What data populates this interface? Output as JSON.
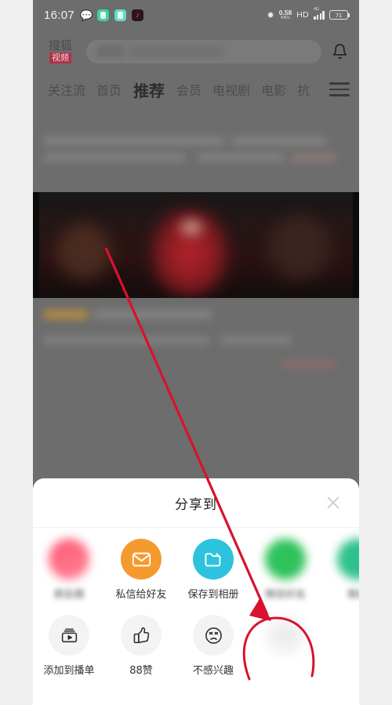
{
  "statusbar": {
    "time": "16:07",
    "tray_icons": [
      "wechat-icon",
      "green-app-icon",
      "teal-app-icon",
      "tiktok-icon"
    ],
    "bluetooth_icon": "bluetooth-icon",
    "net_rate": "0.58",
    "net_rate_unit": "KB/s",
    "hd": "HD",
    "signal_gen": "4G",
    "battery_percent": "71"
  },
  "header": {
    "logo_top": "搜狐",
    "logo_badge": "视频",
    "search_placeholder": "",
    "search_value": "",
    "bell_icon": "bell-icon"
  },
  "nav": {
    "tabs": [
      {
        "label": "关注流",
        "active": false
      },
      {
        "label": "首页",
        "active": false
      },
      {
        "label": "推荐",
        "active": true
      },
      {
        "label": "会员",
        "active": false
      },
      {
        "label": "电视剧",
        "active": false
      },
      {
        "label": "电影",
        "active": false
      },
      {
        "label": "抗",
        "active": false
      }
    ],
    "menu_icon": "hamburger-menu-icon"
  },
  "share_sheet": {
    "title": "分享到",
    "close_icon": "close-icon",
    "row1": [
      {
        "label": "朋友圈",
        "icon": "moments-icon",
        "color": "#ff5a74",
        "blurred": true
      },
      {
        "label": "私信给好友",
        "icon": "mail-icon",
        "color": "#f59a2e",
        "blurred": false
      },
      {
        "label": "保存到相册",
        "icon": "folder-icon",
        "color": "#2bc3dd",
        "blurred": false
      },
      {
        "label": "微信好友",
        "icon": "wechat-icon",
        "color": "#2fc25b",
        "blurred": true
      },
      {
        "label": "微信",
        "icon": "wechat-icon",
        "color": "#2fc18c",
        "blurred": true
      }
    ],
    "row2": [
      {
        "label": "添加到播单",
        "icon": "playlist-icon",
        "color": "#f3f3f5",
        "blurred": false
      },
      {
        "label": "88赞",
        "icon": "thumbs-up-icon",
        "color": "#f3f3f5",
        "blurred": false
      },
      {
        "label": "不感兴趣",
        "icon": "dislike-face-icon",
        "color": "#f3f3f5",
        "blurred": false
      },
      {
        "label": "",
        "icon": "more-icon",
        "color": "#f3f3f5",
        "blurred": true
      }
    ]
  },
  "annotation": {
    "arrow_color": "#d8122e",
    "circle_color": "#d8122e",
    "arrow_from": "135,316",
    "arrow_to": "345,790",
    "circle_target": "share-row2-item-4"
  }
}
